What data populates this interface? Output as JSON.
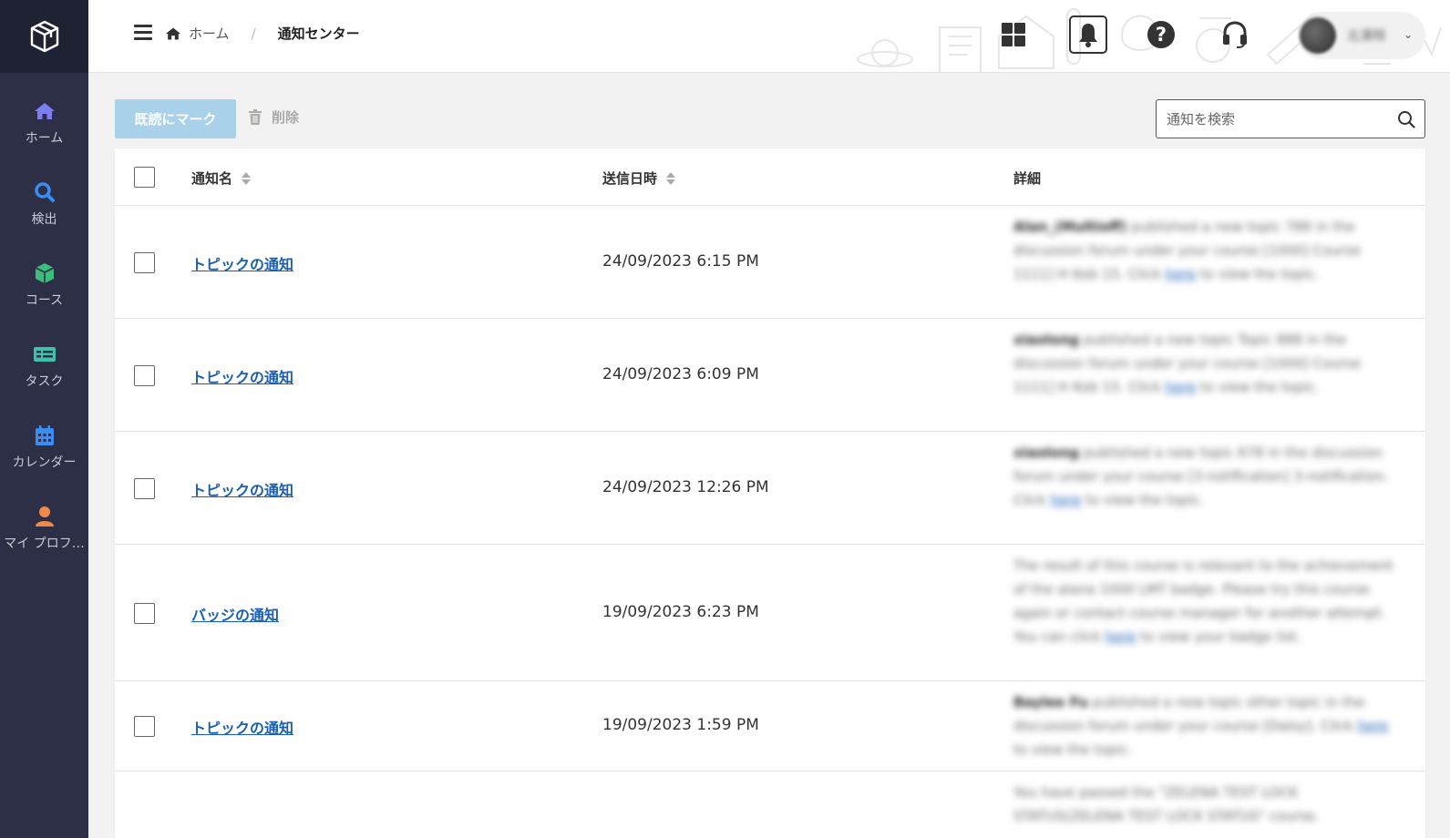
{
  "sidebar": {
    "items": [
      {
        "label": "ホーム",
        "icon": "home-icon",
        "color": "#7b7ff2"
      },
      {
        "label": "検出",
        "icon": "search-icon",
        "color": "#3a8df2"
      },
      {
        "label": "コース",
        "icon": "cube-icon",
        "color": "#3dbd7d"
      },
      {
        "label": "タスク",
        "icon": "task-icon",
        "color": "#3ec2b0"
      },
      {
        "label": "カレンダー",
        "icon": "calendar-icon",
        "color": "#3a8df2"
      },
      {
        "label": "マイ プロフ…",
        "icon": "user-icon",
        "color": "#f08a4b"
      }
    ]
  },
  "header": {
    "breadcrumb": {
      "home": "ホーム",
      "separator": "/",
      "current": "通知センター"
    },
    "user": {
      "name": "北澤翔",
      "caret": "⌄"
    }
  },
  "toolbar": {
    "mark_read": "既読にマーク",
    "delete": "削除",
    "search_placeholder": "通知を検索"
  },
  "table": {
    "columns": {
      "name": "通知名",
      "sent": "送信日時",
      "detail": "詳細"
    },
    "rows": [
      {
        "title": "トピックの通知",
        "date": "24/09/2023 6:15 PM",
        "detail_bold": "Alan_(Multioff)",
        "detail_text": " published a new topic 788 in the discussion forum under your course [1000] Course 1111] H Kob 15. Click ",
        "detail_link": "here",
        "detail_tail": " to view the topic."
      },
      {
        "title": "トピックの通知",
        "date": "24/09/2023 6:09 PM",
        "detail_bold": "xiaolong",
        "detail_text": " published a new topic Topic 888 in the discussion forum under your course [1000] Course 1111] H Kob 15. Click ",
        "detail_link": "here",
        "detail_tail": " to view the topic."
      },
      {
        "title": "トピックの通知",
        "date": "24/09/2023 12:26 PM",
        "detail_bold": "xiaolong",
        "detail_text": " published a new topic 678 in the discussion forum under your course [3-notification] 3-notification. Click ",
        "detail_link": "here",
        "detail_tail": " to view the topic."
      },
      {
        "title": "バッジの通知",
        "date": "19/09/2023 6:23 PM",
        "detail_bold": "",
        "detail_text": "The result of this course is relevant to the achievement of the alana 1000 LMT badge. Please try this course again or contact course manager for another attempt. You can click ",
        "detail_link": "here",
        "detail_tail": " to view your badge list."
      },
      {
        "title": "トピックの通知",
        "date": "19/09/2023 1:59 PM",
        "detail_bold": "Baylee Fu",
        "detail_text": " published a new topic other topic in the discussion forum under your course [Daisy]. Click ",
        "detail_link": "here",
        "detail_tail": " to view the topic."
      },
      {
        "title": "",
        "date": "",
        "detail_bold": "",
        "detail_text": "You have passed the \"ZELENA TEST LOCK STATUS(ZELENA TEST LOCK STATUS\" course.",
        "detail_link": "",
        "detail_tail": ""
      }
    ]
  },
  "colors": {
    "sidebar_bg": "#2c2f45",
    "logo_bg": "#1f2233",
    "accent_blue": "#1a5fb4",
    "mark_button_bg": "#a9d1ea"
  }
}
